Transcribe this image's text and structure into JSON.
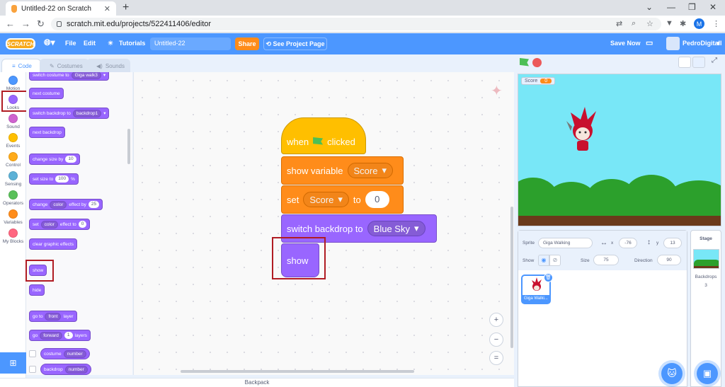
{
  "browser": {
    "tab_title": "Untitled-22 on Scratch",
    "url": "scratch.mit.edu/projects/522411406/editor",
    "profile_initial": "M"
  },
  "menu": {
    "logo": "SCRATCH",
    "file": "File",
    "edit": "Edit",
    "tutorials": "Tutorials",
    "project_title": "Untitled-22",
    "share": "Share",
    "see_project_page": "See Project Page",
    "save_now": "Save Now",
    "username": "PedroDigitall"
  },
  "editor_tabs": [
    "Code",
    "Costumes",
    "Sounds"
  ],
  "categories": [
    {
      "label": "Motion",
      "color": "#4c97ff"
    },
    {
      "label": "Looks",
      "color": "#9966ff"
    },
    {
      "label": "Sound",
      "color": "#cf63cf"
    },
    {
      "label": "Events",
      "color": "#ffbf00"
    },
    {
      "label": "Control",
      "color": "#ffab19"
    },
    {
      "label": "Sensing",
      "color": "#5cb1d6"
    },
    {
      "label": "Operators",
      "color": "#59c059"
    },
    {
      "label": "Variables",
      "color": "#ff8c1a"
    },
    {
      "label": "My Blocks",
      "color": "#ff6680"
    }
  ],
  "palette": {
    "switch_costume": "switch costume to",
    "costume_name": "Giga walk3",
    "next_costume": "next costume",
    "switch_backdrop": "switch backdrop to",
    "backdrop_name": "backdrop1",
    "next_backdrop": "next backdrop",
    "change_size": "change size by",
    "change_size_val": "10",
    "set_size": "set size to",
    "set_size_val": "100",
    "percent": "%",
    "change_effect": "change",
    "effect_color": "color",
    "effect_by": "effect by",
    "change_effect_val": "25",
    "set_effect": "set",
    "effect_to": "effect to",
    "set_effect_val": "0",
    "clear_effects": "clear graphic effects",
    "show": "show",
    "hide": "hide",
    "go_to": "go to",
    "front": "front",
    "layer": "layer",
    "go": "go",
    "forward": "forward",
    "layers_val": "1",
    "layers": "layers",
    "costume_reporter": "costume",
    "number": "number",
    "backdrop_reporter": "backdrop"
  },
  "script": {
    "when": "when",
    "clicked": "clicked",
    "show_variable": "show variable",
    "variable": "Score",
    "set": "set",
    "to": "to",
    "set_value": "0",
    "switch_backdrop": "switch backdrop to",
    "backdrop": "Blue Sky",
    "show": "show"
  },
  "zoom": {
    "in": "+",
    "out": "−",
    "reset": "="
  },
  "backpack": "Backpack",
  "stage": {
    "monitor_label": "Score",
    "monitor_value": "0"
  },
  "sprite_info": {
    "sprite_label": "Sprite",
    "sprite_name": "Giga Walking",
    "x_label": "x",
    "x_value": "-76",
    "y_label": "y",
    "y_value": "13",
    "show_label": "Show",
    "size_label": "Size",
    "size_value": "75",
    "direction_label": "Direction",
    "direction_value": "90",
    "thumb_caption": "Giga Walki..."
  },
  "stage_pane": {
    "title": "Stage",
    "backdrops_label": "Backdrops",
    "backdrops_count": "3"
  },
  "colors": {
    "menu_blue": "#4c97ff",
    "looks": "#9966ff",
    "variables": "#ff8c1a",
    "events": "#ffbf00",
    "highlight": "#b01c23"
  }
}
